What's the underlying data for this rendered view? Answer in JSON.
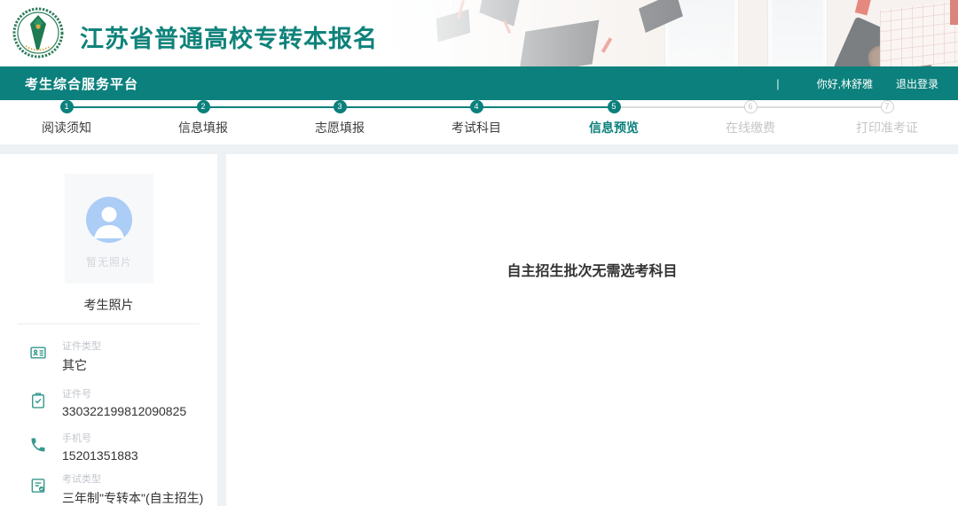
{
  "header": {
    "title": "江苏省普通高校专转本报名"
  },
  "navbar": {
    "platform_title": "考生综合服务平台",
    "separator": "|",
    "greeting": "你好,林舒雅",
    "logout_label": "退出登录"
  },
  "steps": {
    "items": [
      {
        "num": "1",
        "label": "阅读须知",
        "state": "done"
      },
      {
        "num": "2",
        "label": "信息填报",
        "state": "done"
      },
      {
        "num": "3",
        "label": "志愿填报",
        "state": "done"
      },
      {
        "num": "4",
        "label": "考试科目",
        "state": "done"
      },
      {
        "num": "5",
        "label": "信息预览",
        "state": "active"
      },
      {
        "num": "6",
        "label": "在线缴费",
        "state": "pending"
      },
      {
        "num": "7",
        "label": "打印准考证",
        "state": "pending"
      }
    ]
  },
  "sidebar": {
    "photo_placeholder": "暂无照片",
    "photo_label": "考生照片",
    "fields": [
      {
        "icon": "id-card-icon",
        "label": "证件类型",
        "value": "其它"
      },
      {
        "icon": "clipboard-check-icon",
        "label": "证件号",
        "value": "330322199812090825"
      },
      {
        "icon": "phone-icon",
        "label": "手机号",
        "value": "15201351883"
      },
      {
        "icon": "exam-type-icon",
        "label": "考试类型",
        "value": "三年制\"专转本\"(自主招生)"
      }
    ]
  },
  "main": {
    "message": "自主招生批次无需选考科目"
  },
  "colors": {
    "primary_teal": "#0b807c",
    "icon_teal": "#35998f",
    "avatar_blue": "#abcdf6",
    "pending_gray": "#c6c6c6"
  }
}
